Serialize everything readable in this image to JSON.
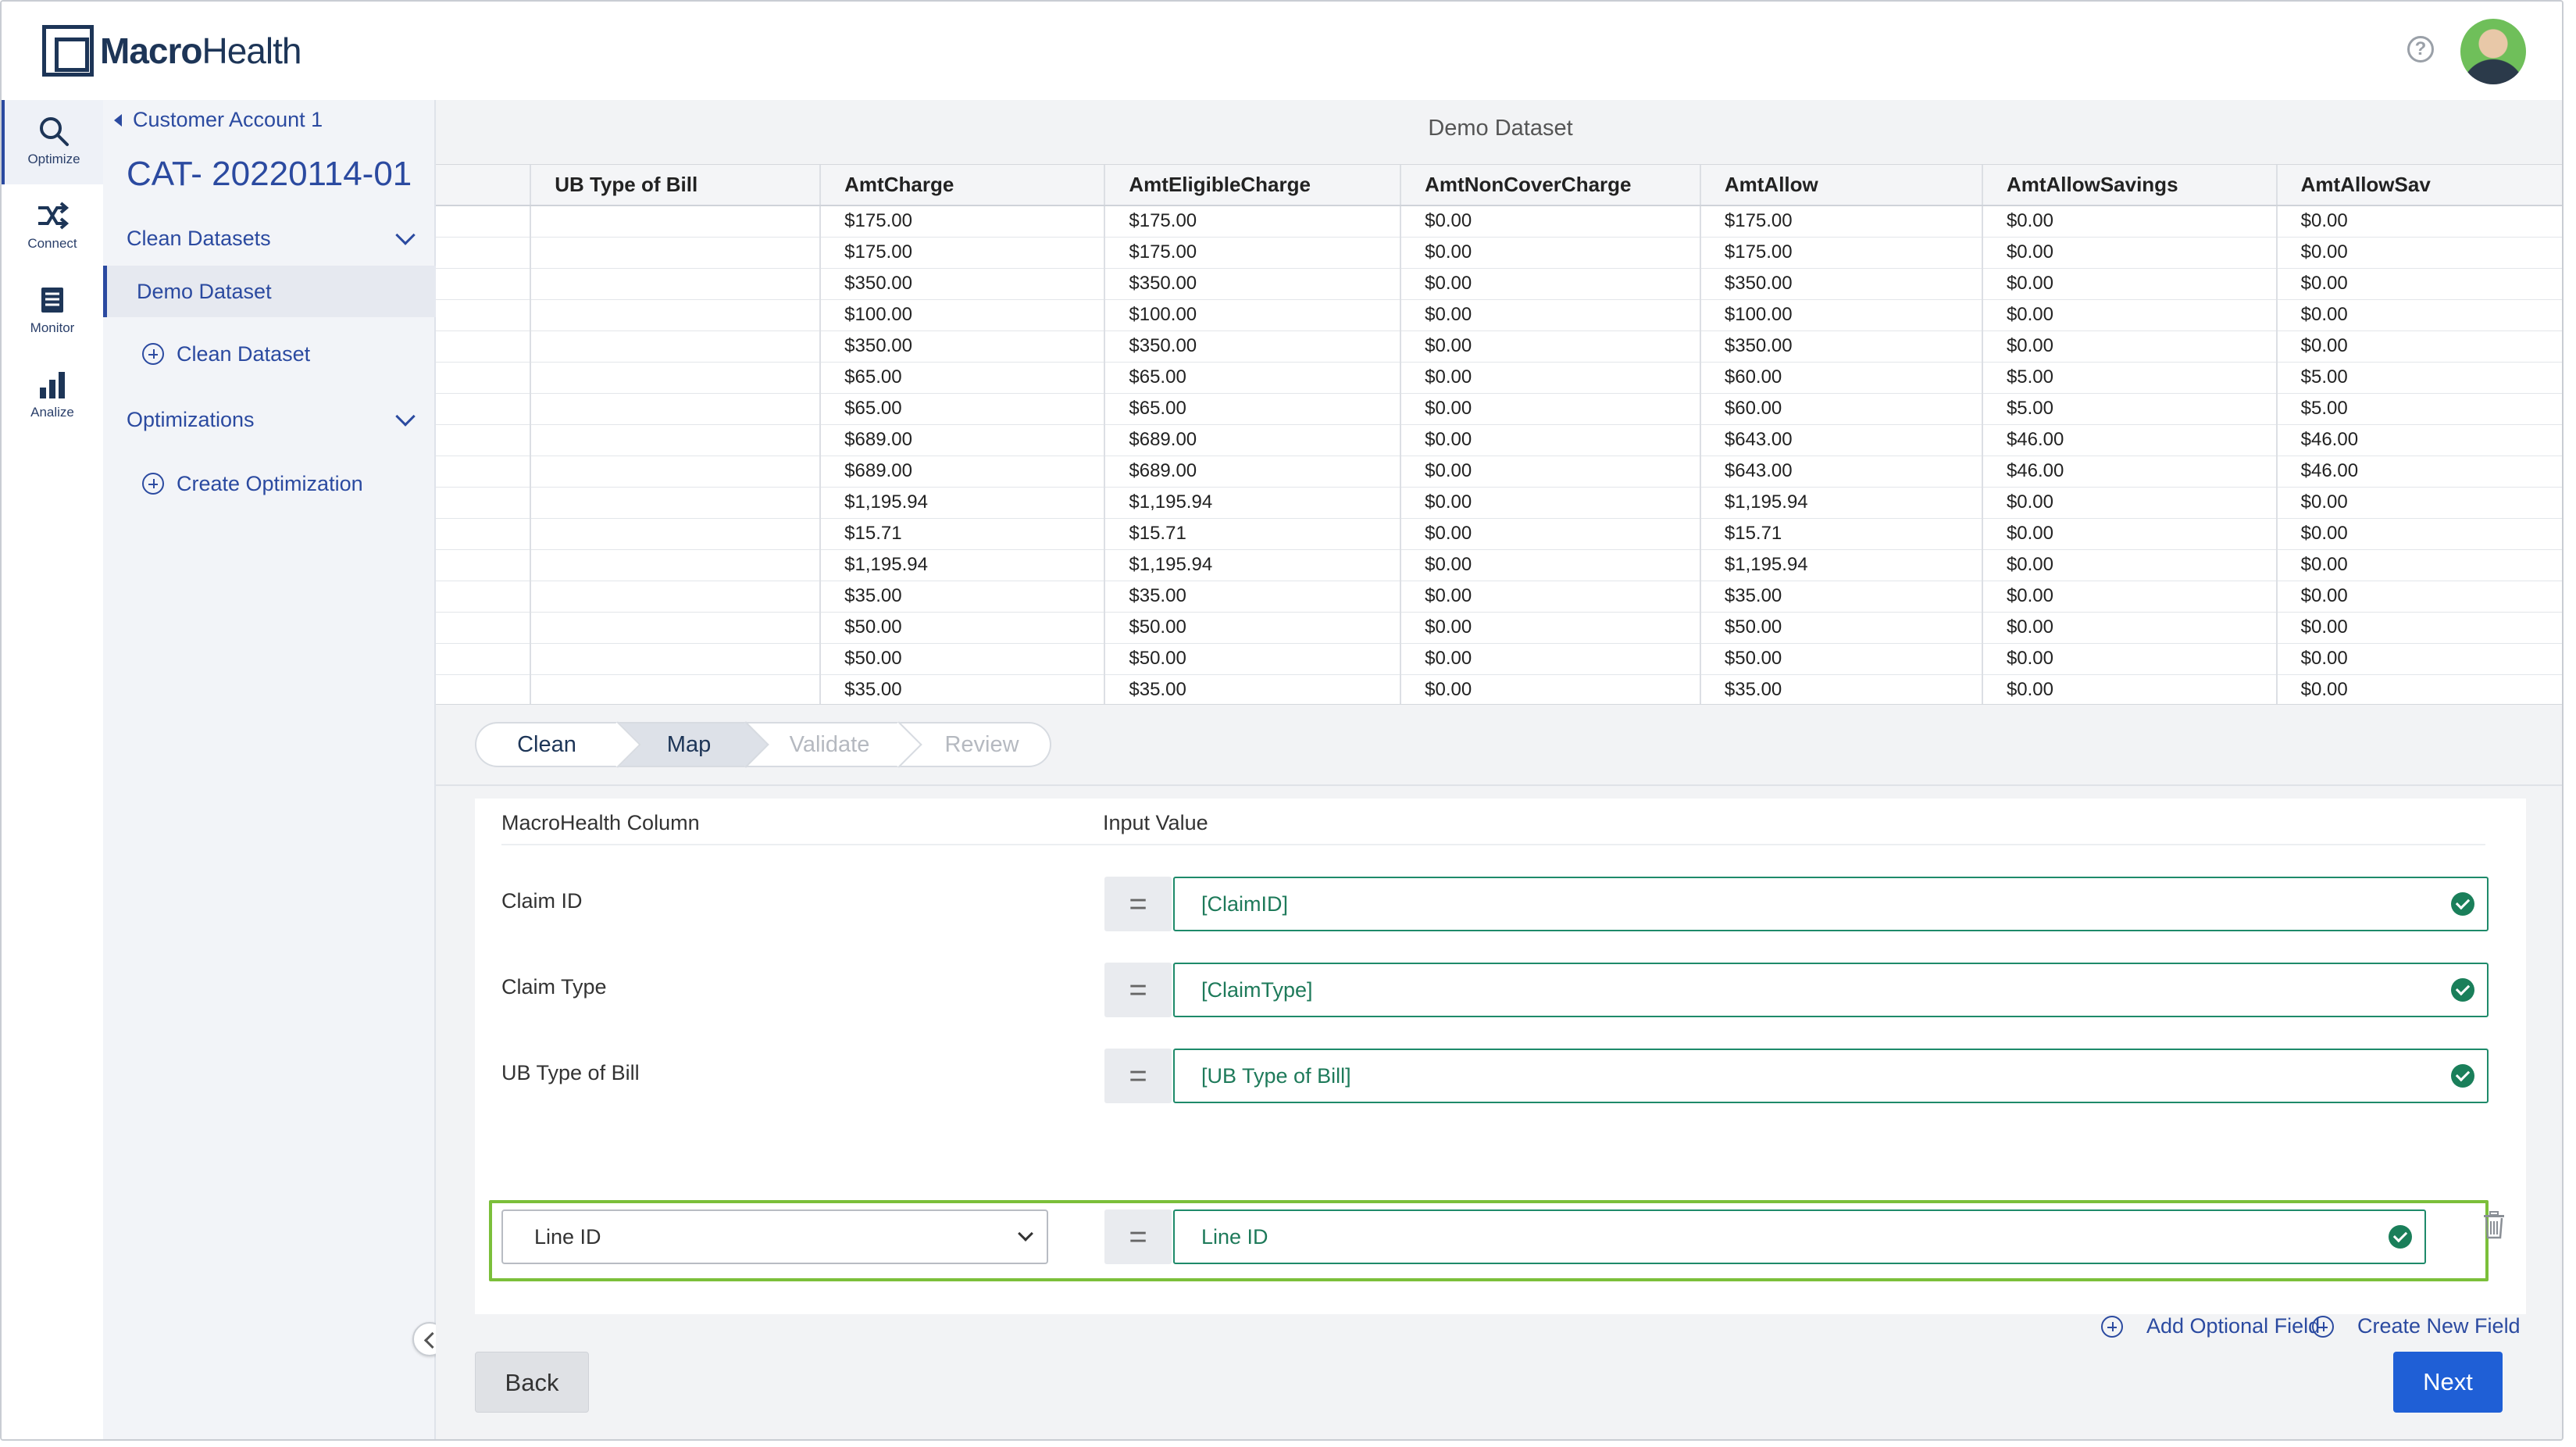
{
  "brand": {
    "name_bold": "Macro",
    "name_light": "Health"
  },
  "header": {
    "help_symbol": "?"
  },
  "rail": [
    {
      "label": "Optimize",
      "icon": "search-icon",
      "glyph": "⚲"
    },
    {
      "label": "Connect",
      "icon": "shuffle-icon",
      "glyph": "⤨"
    },
    {
      "label": "Monitor",
      "icon": "document-icon",
      "glyph": "▤"
    },
    {
      "label": "Analize",
      "icon": "bar-chart-icon",
      "glyph": "▟"
    }
  ],
  "sidebar": {
    "back_label": "Customer Account 1",
    "project_title": "CAT- 20220114-01",
    "clean_datasets_label": "Clean Datasets",
    "demo_dataset_label": "Demo Dataset",
    "add_clean_dataset_label": "Clean Dataset",
    "optimizations_label": "Optimizations",
    "create_optimization_label": "Create Optimization"
  },
  "dataset": {
    "title": "Demo Dataset",
    "columns": [
      "",
      "UB Type of Bill",
      "AmtCharge",
      "AmtEligibleCharge",
      "AmtNonCoverCharge",
      "AmtAllow",
      "AmtAllowSavings",
      "AmtAllowSav"
    ],
    "rows": [
      [
        "",
        "",
        "$175.00",
        "$175.00",
        "$0.00",
        "$175.00",
        "$0.00",
        "$0.00"
      ],
      [
        "",
        "",
        "$175.00",
        "$175.00",
        "$0.00",
        "$175.00",
        "$0.00",
        "$0.00"
      ],
      [
        "",
        "",
        "$350.00",
        "$350.00",
        "$0.00",
        "$350.00",
        "$0.00",
        "$0.00"
      ],
      [
        "",
        "",
        "$100.00",
        "$100.00",
        "$0.00",
        "$100.00",
        "$0.00",
        "$0.00"
      ],
      [
        "",
        "",
        "$350.00",
        "$350.00",
        "$0.00",
        "$350.00",
        "$0.00",
        "$0.00"
      ],
      [
        "",
        "",
        "$65.00",
        "$65.00",
        "$0.00",
        "$60.00",
        "$5.00",
        "$5.00"
      ],
      [
        "",
        "",
        "$65.00",
        "$65.00",
        "$0.00",
        "$60.00",
        "$5.00",
        "$5.00"
      ],
      [
        "",
        "",
        "$689.00",
        "$689.00",
        "$0.00",
        "$643.00",
        "$46.00",
        "$46.00"
      ],
      [
        "",
        "",
        "$689.00",
        "$689.00",
        "$0.00",
        "$643.00",
        "$46.00",
        "$46.00"
      ],
      [
        "",
        "",
        "$1,195.94",
        "$1,195.94",
        "$0.00",
        "$1,195.94",
        "$0.00",
        "$0.00"
      ],
      [
        "",
        "",
        "$15.71",
        "$15.71",
        "$0.00",
        "$15.71",
        "$0.00",
        "$0.00"
      ],
      [
        "",
        "",
        "$1,195.94",
        "$1,195.94",
        "$0.00",
        "$1,195.94",
        "$0.00",
        "$0.00"
      ],
      [
        "",
        "",
        "$35.00",
        "$35.00",
        "$0.00",
        "$35.00",
        "$0.00",
        "$0.00"
      ],
      [
        "",
        "",
        "$50.00",
        "$50.00",
        "$0.00",
        "$50.00",
        "$0.00",
        "$0.00"
      ],
      [
        "",
        "",
        "$50.00",
        "$50.00",
        "$0.00",
        "$50.00",
        "$0.00",
        "$0.00"
      ],
      [
        "",
        "",
        "$35.00",
        "$35.00",
        "$0.00",
        "$35.00",
        "$0.00",
        "$0.00"
      ]
    ]
  },
  "steps": [
    {
      "label": "Clean",
      "state": "done"
    },
    {
      "label": "Map",
      "state": "current"
    },
    {
      "label": "Validate",
      "state": "upcoming"
    },
    {
      "label": "Review",
      "state": "upcoming"
    }
  ],
  "mapping": {
    "col_macrohealth": "MacroHealth Column",
    "col_input": "Input Value",
    "equals_symbol": "=",
    "rows": [
      {
        "label": "Claim ID",
        "value": "[ClaimID]"
      },
      {
        "label": "Claim Type",
        "value": "[ClaimType]"
      },
      {
        "label": "UB Type of Bill",
        "value": "[UB Type of Bill]"
      }
    ],
    "optional_row": {
      "selected": "Line ID",
      "value": "Line ID"
    },
    "add_optional_field": "Add Optional Field",
    "create_new_field": "Create New Field"
  },
  "footer": {
    "back_label": "Back",
    "next_label": "Next"
  },
  "colors": {
    "accent": "#2b4aa0",
    "success": "#1a7f5a",
    "highlight": "#7bbf3a",
    "primary_button": "#1f5fd6"
  }
}
